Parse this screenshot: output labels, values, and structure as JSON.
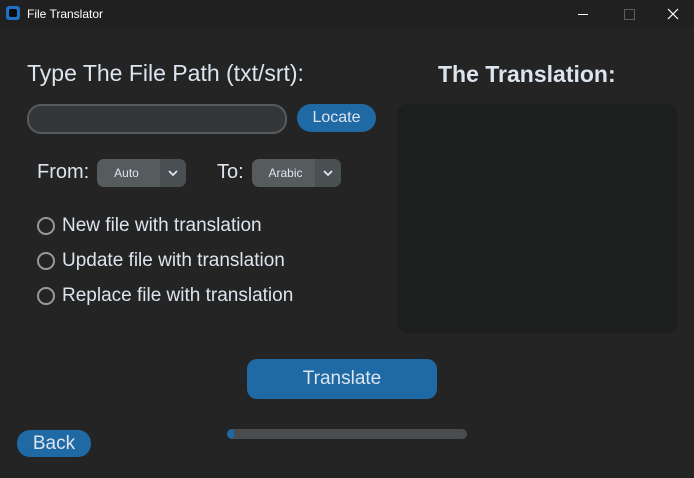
{
  "window": {
    "title": "File Translator",
    "minimize_icon": "minimize-icon",
    "maximize_icon": "maximize-icon",
    "close_icon": "close-icon"
  },
  "file": {
    "label": "Type The File Path (txt/srt):",
    "path_value": "",
    "locate_label": "Locate"
  },
  "languages": {
    "from_label": "From:",
    "from_value": "Auto",
    "to_label": "To:",
    "to_value": "Arabic",
    "dropdown_icon": "chevron-down-icon"
  },
  "options": [
    {
      "label": "New file with translation",
      "selected": false
    },
    {
      "label": "Update file with translation",
      "selected": false
    },
    {
      "label": "Replace file with translation",
      "selected": false
    }
  ],
  "translation": {
    "title": "The Translation:",
    "text": ""
  },
  "actions": {
    "translate_label": "Translate",
    "back_label": "Back"
  },
  "progress": {
    "value": 0.03
  },
  "colors": {
    "background": "#242424",
    "accent": "#1f6aa5",
    "textbox": "#1d1e1e"
  }
}
